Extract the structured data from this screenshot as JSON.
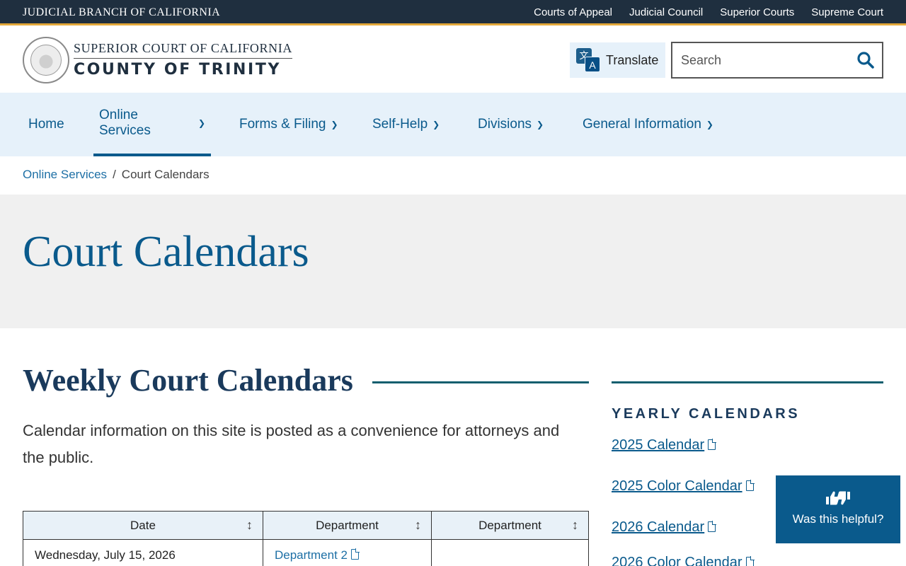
{
  "topbar": {
    "brand": "JUDICIAL BRANCH OF CALIFORNIA",
    "links": [
      "Courts of Appeal",
      "Judicial Council",
      "Superior Courts",
      "Supreme Court"
    ]
  },
  "header": {
    "logo_top": "SUPERIOR COURT OF CALIFORNIA",
    "logo_bottom": "COUNTY OF TRINITY",
    "translate_label": "Translate",
    "search_placeholder": "Search"
  },
  "nav": {
    "items": [
      {
        "label": "Home"
      },
      {
        "label": "Online Services"
      },
      {
        "label": "Forms & Filing"
      },
      {
        "label": "Self-Help"
      },
      {
        "label": "Divisions"
      },
      {
        "label": "General Information"
      }
    ]
  },
  "breadcrumb": {
    "parent": "Online Services",
    "separator": "/",
    "current": "Court Calendars"
  },
  "hero": {
    "title": "Court Calendars"
  },
  "main": {
    "section_title": "Weekly Court Calendars",
    "intro": "Calendar information on this site is posted as a convenience for attorneys and the public.",
    "table": {
      "headers": [
        "Date",
        "Department",
        "Department"
      ],
      "rows": [
        {
          "date": "Wednesday, July 15, 2026",
          "dept1": "Department 2",
          "dept2": ""
        }
      ]
    }
  },
  "sidebar": {
    "title": "YEARLY CALENDARS",
    "links": [
      "2025 Calendar",
      "2025 Color Calendar",
      "2026 Calendar",
      "2026 Color Calendar"
    ]
  },
  "feedback": {
    "label": "Was this helpful?"
  },
  "colors": {
    "topbar": "#1f2f3f",
    "accent_gold": "#e3a83a",
    "primary_blue": "#0a5a8c",
    "nav_bg": "#e6f1fa",
    "hero_bg": "#f0f0f0",
    "rule_teal": "#0f5e6e"
  }
}
